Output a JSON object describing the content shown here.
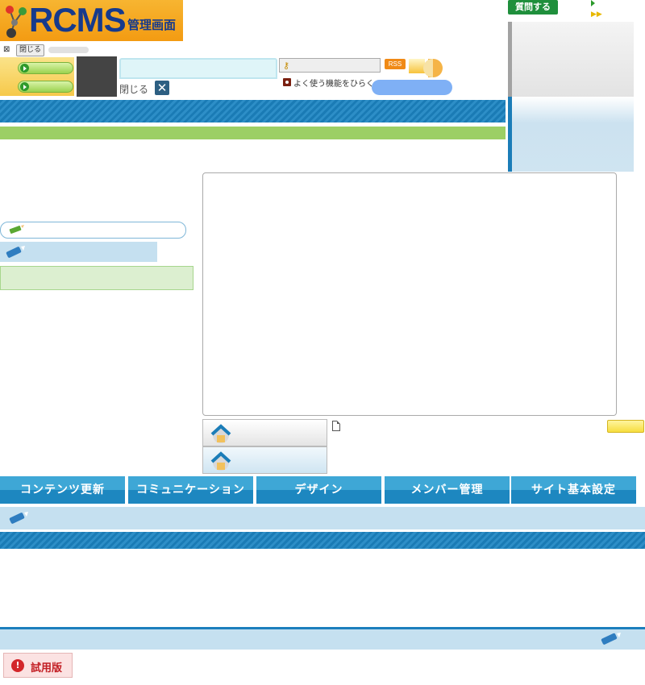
{
  "logo": {
    "brand": "RCMS",
    "subtitle": "管理画面"
  },
  "header": {
    "close_small": "閉じる",
    "close_label": "閉じる",
    "key_input_icon": "key-icon",
    "rss": "RSS",
    "favorites_link": "よく使う機能をひらく"
  },
  "right": {
    "ask_button": "質問する",
    "arrow_more": "▶▶"
  },
  "nav": {
    "items": [
      "コンテンツ更新",
      "コミュニケーション",
      "デザイン",
      "メンバー管理",
      "サイト基本設定"
    ]
  },
  "footer": {
    "trial_badge": "試用版"
  },
  "colors": {
    "brand_orange": "#f39b12",
    "brand_blue": "#163a8c",
    "accent_blue": "#1d87c0",
    "accent_green": "#9ccf65",
    "light_blue": "#c5e0f0"
  }
}
